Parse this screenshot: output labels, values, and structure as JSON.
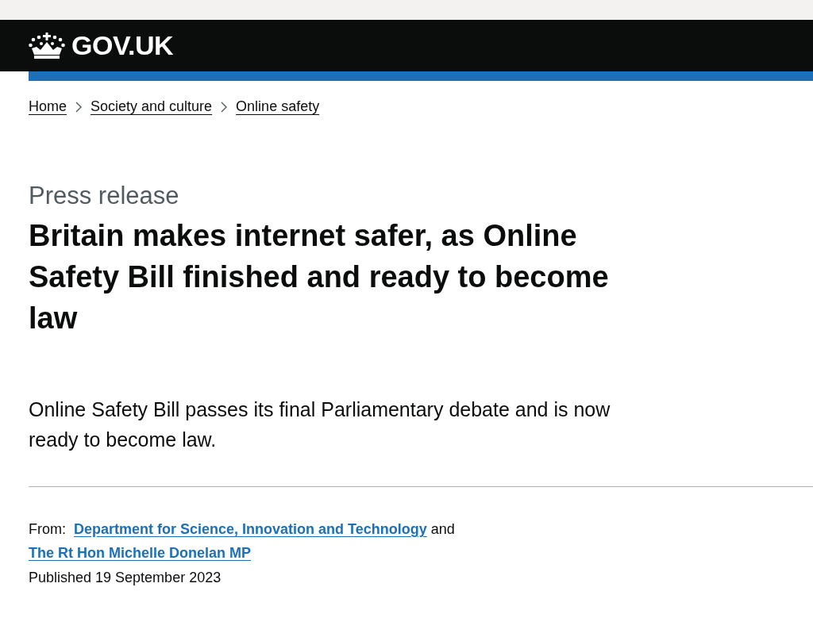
{
  "header": {
    "logo_text": "GOV.UK"
  },
  "breadcrumbs": [
    {
      "label": "Home"
    },
    {
      "label": "Society and culture"
    },
    {
      "label": "Online safety"
    }
  ],
  "document_type": "Press release",
  "title": "Britain makes internet safer, as Online Safety Bill finished and ready to become law",
  "lede": "Online Safety Bill passes its final Parliamentary debate and is now ready to become law.",
  "metadata": {
    "from_label": "From:",
    "from_links": [
      "Department for Science, Innovation and Technology",
      "The Rt Hon Michelle Donelan MP"
    ],
    "joiner": "and",
    "published": "Published 19 September 2023"
  }
}
